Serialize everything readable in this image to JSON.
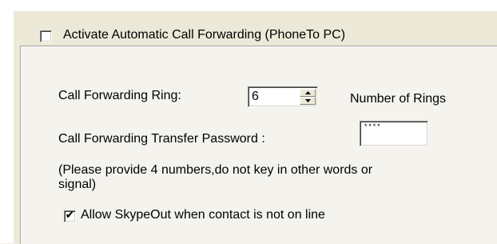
{
  "activate_forwarding": {
    "label": "Activate Automatic Call Forwarding (PhoneTo PC)",
    "checked": false
  },
  "ring": {
    "label": "Call Forwarding Ring:",
    "value": "6",
    "suffix": "Number of Rings"
  },
  "transfer_password": {
    "label": "Call Forwarding Transfer Password :",
    "value": "****"
  },
  "note": {
    "line1": "(Please provide 4 numbers,do not key in other words or",
    "line2": "signal)"
  },
  "allow_skypeout": {
    "label": "Allow SkypeOut when contact is not on line",
    "checked": true,
    "mark": "✔"
  },
  "icons": {
    "spinner_up": "triangle-up-icon",
    "spinner_down": "triangle-down-icon",
    "checkmark": "checkmark-icon"
  }
}
